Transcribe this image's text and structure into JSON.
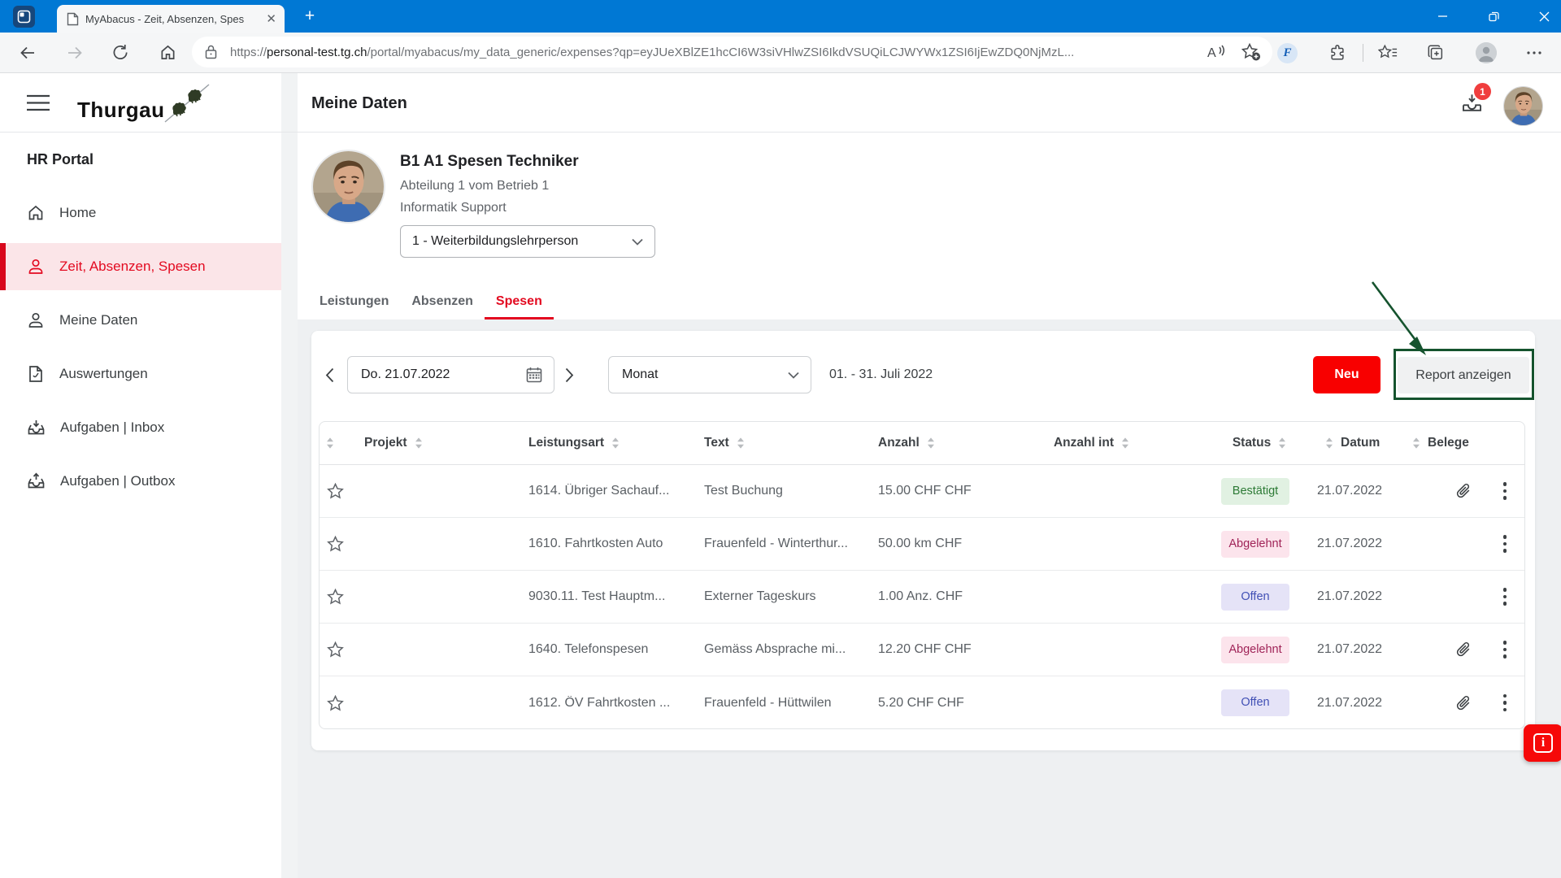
{
  "browser": {
    "tab_title": "MyAbacus - Zeit, Absenzen, Spes",
    "url_scheme": "https://",
    "url_domain": "personal-test.tg.ch",
    "url_path": "/portal/myabacus/my_data_generic/expenses?qp=eyJUeXBlZE1hcCI6W3siVHlwZSI6IkdVSUQiLCJWYWx1ZSI6IjEwZDQ0NjMzL...",
    "accent_blue": "#0078d4"
  },
  "sidebar": {
    "logo_text": "Thurgau",
    "section_title": "HR Portal",
    "items": [
      {
        "label": "Home",
        "active": false
      },
      {
        "label": "Zeit, Absenzen, Spesen",
        "active": true
      },
      {
        "label": "Meine Daten",
        "active": false
      },
      {
        "label": "Auswertungen",
        "active": false
      },
      {
        "label": "Aufgaben | Inbox",
        "active": false
      },
      {
        "label": "Aufgaben | Outbox",
        "active": false
      }
    ],
    "accent_red": "#e30a20",
    "active_bg": "#fbe5e8"
  },
  "header": {
    "title": "Meine Daten",
    "notification_count": "1"
  },
  "profile": {
    "name": "B1 A1 Spesen Techniker",
    "line1": "Abteilung 1 vom Betrieb 1",
    "line2": "Informatik Support",
    "role_select_value": "1 - Weiterbildungslehrperson"
  },
  "tabs": [
    {
      "label": "Leistungen",
      "active": false
    },
    {
      "label": "Absenzen",
      "active": false
    },
    {
      "label": "Spesen",
      "active": true
    }
  ],
  "toolbar": {
    "date_value": "Do. 21.07.2022",
    "period_select_value": "Monat",
    "range_label": "01. - 31. Juli 2022",
    "new_button": "Neu",
    "report_button": "Report anzeigen"
  },
  "table": {
    "columns": [
      "Projekt",
      "Leistungsart",
      "Text",
      "Anzahl",
      "Anzahl int",
      "Status",
      "Datum",
      "Belege"
    ],
    "rows": [
      {
        "projekt": "",
        "leistungsart": "1614. Übriger Sachauf...",
        "text": "Test Buchung",
        "anzahl": "15.00 CHF CHF",
        "anzahl_int": "",
        "status": "Bestätigt",
        "status_type": "green",
        "datum": "21.07.2022",
        "attachment": true
      },
      {
        "projekt": "",
        "leistungsart": "1610. Fahrtkosten Auto",
        "text": "Frauenfeld - Winterthur...",
        "anzahl": "50.00 km CHF",
        "anzahl_int": "",
        "status": "Abgelehnt",
        "status_type": "pink",
        "datum": "21.07.2022",
        "attachment": false
      },
      {
        "projekt": "",
        "leistungsart": "9030.11. Test Hauptm...",
        "text": "Externer Tageskurs",
        "anzahl": "1.00 Anz. CHF",
        "anzahl_int": "",
        "status": "Offen",
        "status_type": "purple",
        "datum": "21.07.2022",
        "attachment": false
      },
      {
        "projekt": "",
        "leistungsart": "1640. Telefonspesen",
        "text": "Gemäss Absprache mi...",
        "anzahl": "12.20 CHF CHF",
        "anzahl_int": "",
        "status": "Abgelehnt",
        "status_type": "pink",
        "datum": "21.07.2022",
        "attachment": true
      },
      {
        "projekt": "",
        "leistungsart": "1612. ÖV Fahrtkosten ...",
        "text": "Frauenfeld - Hüttwilen",
        "anzahl": "5.20 CHF CHF",
        "anzahl_int": "",
        "status": "Offen",
        "status_type": "purple",
        "datum": "21.07.2022",
        "attachment": true
      }
    ]
  },
  "annotation": {
    "color": "#15532e"
  },
  "status_colors": {
    "green_bg": "#e1f1e2",
    "green_text": "#2c7a35",
    "pink_bg": "#fce4ec",
    "pink_text": "#a02458",
    "purple_bg": "#e5e3f7",
    "purple_text": "#4150b5"
  }
}
